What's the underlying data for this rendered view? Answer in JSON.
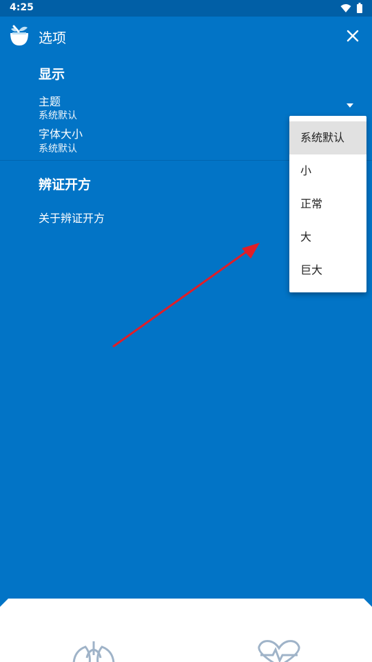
{
  "status_bar": {
    "time": "4:25",
    "icons": [
      "wifi-icon",
      "battery-icon"
    ]
  },
  "app_bar": {
    "title": "选项",
    "logo": "mortar-pestle-logo",
    "close_icon": "close-icon"
  },
  "sections": {
    "display": {
      "header": "显示",
      "theme": {
        "title": "主题",
        "summary": "系统默认"
      },
      "font_size": {
        "title": "字体大小",
        "summary": "系统默认"
      }
    },
    "about": {
      "header": "辨证开方",
      "item": "关于辨证开方"
    }
  },
  "font_size_menu": {
    "options": [
      "系统默认",
      "小",
      "正常",
      "大",
      "巨大"
    ],
    "selected_index": 0
  },
  "bottom_nav": {
    "icons": [
      "lungs-icon",
      "heart-pulse-icon"
    ]
  },
  "colors": {
    "primary": "#0274c6",
    "status_bar": "#015fa6",
    "annotation_arrow": "#e01e28",
    "menu_selected": "#e1e1e1"
  }
}
